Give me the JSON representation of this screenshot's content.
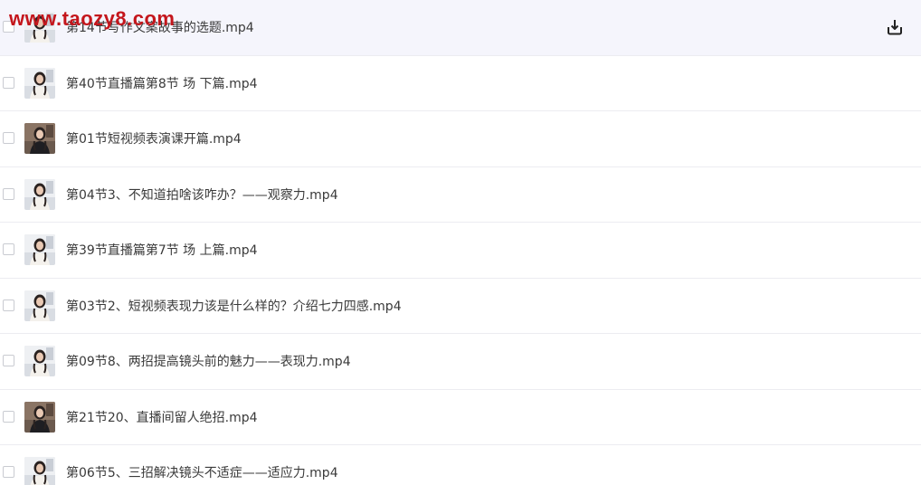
{
  "watermark": "www.taozy8.com",
  "files": [
    {
      "name": "第14节写作文案故事的选题.mp4",
      "thumb": "light"
    },
    {
      "name": "第40节直播篇第8节 场 下篇.mp4",
      "thumb": "light"
    },
    {
      "name": "第01节短视频表演课开篇.mp4",
      "thumb": "dark"
    },
    {
      "name": "第04节3、不知道拍啥该咋办？——观察力.mp4",
      "thumb": "light"
    },
    {
      "name": "第39节直播篇第7节 场 上篇.mp4",
      "thumb": "light"
    },
    {
      "name": "第03节2、短视频表现力该是什么样的？介绍七力四感.mp4",
      "thumb": "light"
    },
    {
      "name": "第09节8、两招提高镜头前的魅力——表现力.mp4",
      "thumb": "light"
    },
    {
      "name": "第21节20、直播间留人绝招.mp4",
      "thumb": "dark"
    },
    {
      "name": "第06节5、三招解决镜头不适症——适应力.mp4",
      "thumb": "light"
    }
  ],
  "icons": {
    "download": "download-icon",
    "thumbnail": "video-thumbnail"
  },
  "colors": {
    "hover_row": "#f5f5fc",
    "watermark": "#c4161c",
    "text": "#3a3a3a"
  }
}
